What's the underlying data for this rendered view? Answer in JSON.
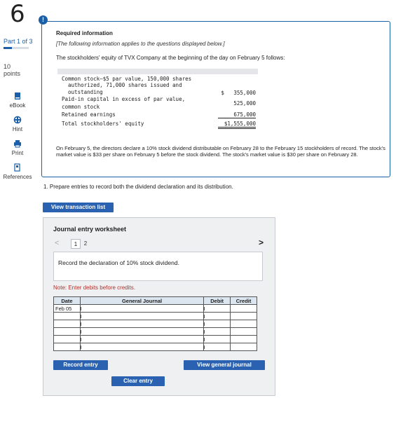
{
  "question": {
    "number": "6",
    "part": "Part 1 of 3",
    "points_value": "10",
    "points_label": "points"
  },
  "tools": [
    {
      "label": "eBook",
      "icon": "book-icon"
    },
    {
      "label": "Hint",
      "icon": "hint-icon"
    },
    {
      "label": "Print",
      "icon": "print-icon"
    },
    {
      "label": "References",
      "icon": "references-icon"
    }
  ],
  "info": {
    "alert": "!",
    "title": "Required information",
    "subtitle": "[The following information applies to the questions displayed below.]",
    "intro": "The stockholders' equity of TVX Company at the beginning of the day on February 5 follows:",
    "equity_lines": [
      "Common stock—$5 par value, 150,000 shares",
      "  authorized, 71,000 shares issued and",
      "  outstanding",
      "Paid-in capital in excess of par value,",
      "common stock",
      "Retained earnings",
      "Total stockholders' equity"
    ],
    "amounts": {
      "common_stock": "$   355,000",
      "paid_in": "525,000",
      "retained": "675,000",
      "total": "$1,555,000"
    },
    "paragraph": "On February 5, the directors declare a 10% stock dividend distributable on February 28 to the February 15 stockholders of record. The stock's market value is $33 per share on February 5 before the stock dividend. The stock's market value is $30 per share on February 28."
  },
  "question_text": "1. Prepare entries to record both the dividend declaration and its distribution.",
  "buttons": {
    "view_transactions": "View transaction list",
    "record_entry": "Record entry",
    "view_journal": "View general journal",
    "clear_entry": "Clear entry"
  },
  "worksheet": {
    "title": "Journal entry worksheet",
    "nav_prev": "<",
    "nav_next": ">",
    "pages": [
      "1",
      "2"
    ],
    "prompt": "Record the declaration of 10% stock dividend.",
    "note": "Note: Enter debits before credits.",
    "columns": [
      "Date",
      "General Journal",
      "Debit",
      "Credit"
    ],
    "first_date": "Feb 05"
  },
  "colors": {
    "accent": "#2a62b1",
    "note_red": "#b0332c",
    "panel_bg": "#eef0f2",
    "header_bg": "#dce6f1"
  }
}
